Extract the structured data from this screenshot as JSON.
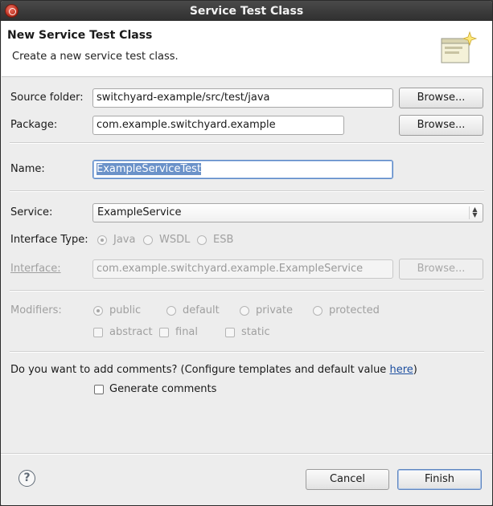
{
  "window": {
    "title": "Service Test Class"
  },
  "header": {
    "title": "New Service Test Class",
    "description": "Create a new service test class."
  },
  "source_folder": {
    "label": "Source folder:",
    "value": "switchyard-example/src/test/java",
    "browse_label": "Browse..."
  },
  "package": {
    "label": "Package:",
    "value": "com.example.switchyard.example",
    "browse_label": "Browse..."
  },
  "name": {
    "label": "Name:",
    "value": "ExampleServiceTest"
  },
  "service": {
    "label": "Service:",
    "selected": "ExampleService"
  },
  "interface_type": {
    "label": "Interface Type:",
    "options": [
      "Java",
      "WSDL",
      "ESB"
    ],
    "selected": "Java"
  },
  "interface": {
    "label": "Interface:",
    "value": "com.example.switchyard.example.ExampleService",
    "browse_label": "Browse..."
  },
  "modifiers": {
    "label": "Modifiers:",
    "access": [
      "public",
      "default",
      "private",
      "protected"
    ],
    "selected": "public",
    "flags": [
      "abstract",
      "final",
      "static"
    ]
  },
  "comments": {
    "question": "Do you want to add comments? (Configure templates and default value ",
    "link": "here",
    "question_end": ")",
    "generate_label": "Generate comments"
  },
  "footer": {
    "cancel_label": "Cancel",
    "finish_label": "Finish"
  },
  "icons": {
    "app": "eclipse-logo-icon",
    "wizard": "new-class-wizard-icon",
    "help": "help-icon"
  },
  "colors": {
    "link": "#1d4fa0",
    "selection": "#6b92c9",
    "titlebar": "#3a3a3a"
  }
}
